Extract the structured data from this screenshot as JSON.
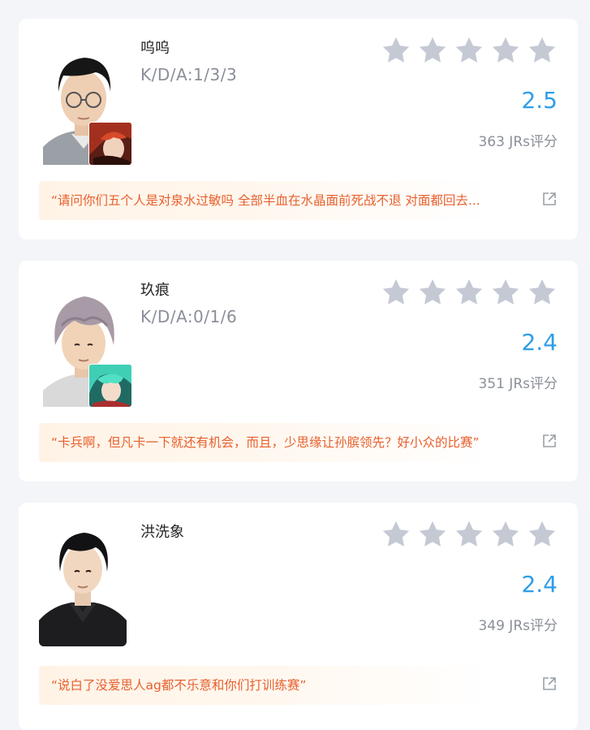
{
  "colors": {
    "score": "#2f9ee8",
    "quote_text": "#e8602c",
    "quote_bg": "#fff3e6",
    "star_empty": "#c4c9d4",
    "muted": "#8a8f99"
  },
  "players": [
    {
      "name": "呜呜",
      "kda": "K/D/A:1/3/3",
      "rating": "2.5",
      "rating_value": 2.5,
      "stars_filled": 0,
      "stars_total": 5,
      "raters": "363 JRs评分",
      "quote": "“请问你们五个人是对泉水过敏吗 全部半血在水晶面前死战不退 对面都回去...",
      "hero_icon": "hero-avatar-red-haired"
    },
    {
      "name": "玖痕",
      "kda": "K/D/A:0/1/6",
      "rating": "2.4",
      "rating_value": 2.4,
      "stars_filled": 0,
      "stars_total": 5,
      "raters": "351 JRs评分",
      "quote": "“卡兵啊，但凡卡一下就还有机会，而且，少思缘让孙膑领先？好小众的比赛”",
      "hero_icon": "hero-avatar-teal-haired"
    },
    {
      "name": "洪洗象",
      "kda": "",
      "rating": "2.4",
      "rating_value": 2.4,
      "stars_filled": 0,
      "stars_total": 5,
      "raters": "349 JRs评分",
      "quote": "“说白了没爱思人ag都不乐意和你们打训练赛”",
      "hero_icon": ""
    }
  ]
}
